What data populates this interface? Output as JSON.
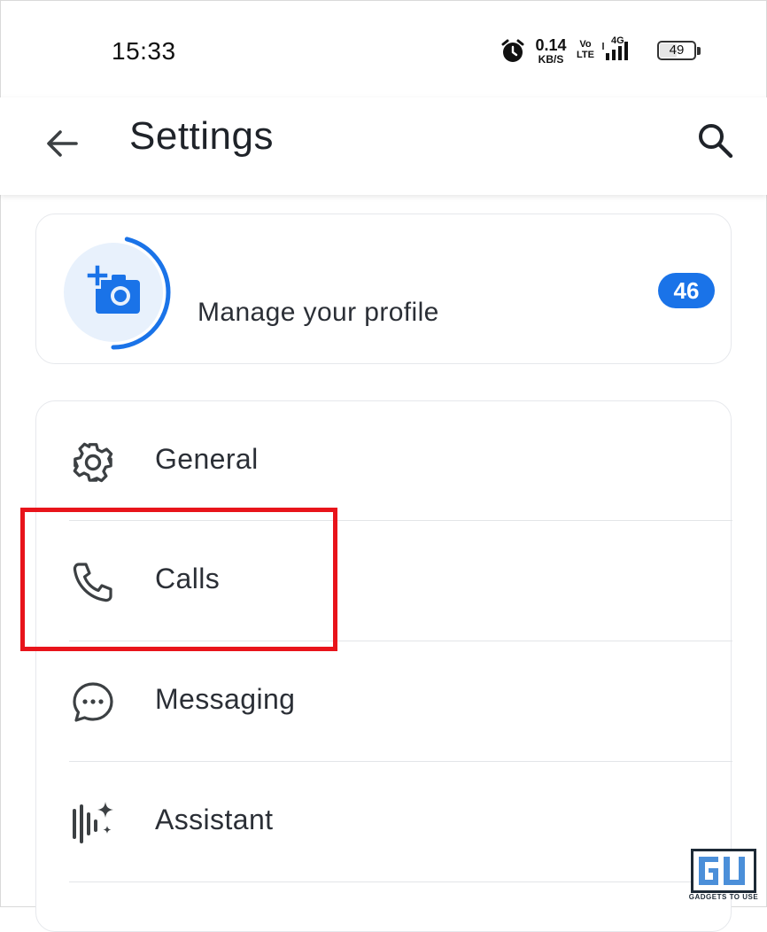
{
  "status_bar": {
    "time": "15:33",
    "net_speed_value": "0.14",
    "net_speed_unit": "KB/S",
    "volte_top": "Vo",
    "volte_bottom": "LTE",
    "network_type": "4G",
    "battery_level": "49",
    "icons": [
      "alarm-icon",
      "signal-icon",
      "battery-icon"
    ]
  },
  "app_bar": {
    "title": "Settings",
    "back_icon": "arrow-back-icon",
    "search_icon": "search-icon"
  },
  "profile": {
    "label": "Manage your profile",
    "badge_count": "46",
    "avatar_icon": "add-photo-camera-icon",
    "progress_fraction": 0.46,
    "accent_color": "#1a73e8"
  },
  "settings_list": {
    "items": [
      {
        "label": "General",
        "icon": "gear-icon"
      },
      {
        "label": "Calls",
        "icon": "phone-icon"
      },
      {
        "label": "Messaging",
        "icon": "chat-bubble-icon"
      },
      {
        "label": "Assistant",
        "icon": "assistant-sparkle-icon"
      }
    ]
  },
  "annotation": {
    "highlight_target": "Calls",
    "highlight_color": "#e8141b"
  },
  "watermark": {
    "logo": "GU",
    "text": "GADGETS TO USE"
  }
}
